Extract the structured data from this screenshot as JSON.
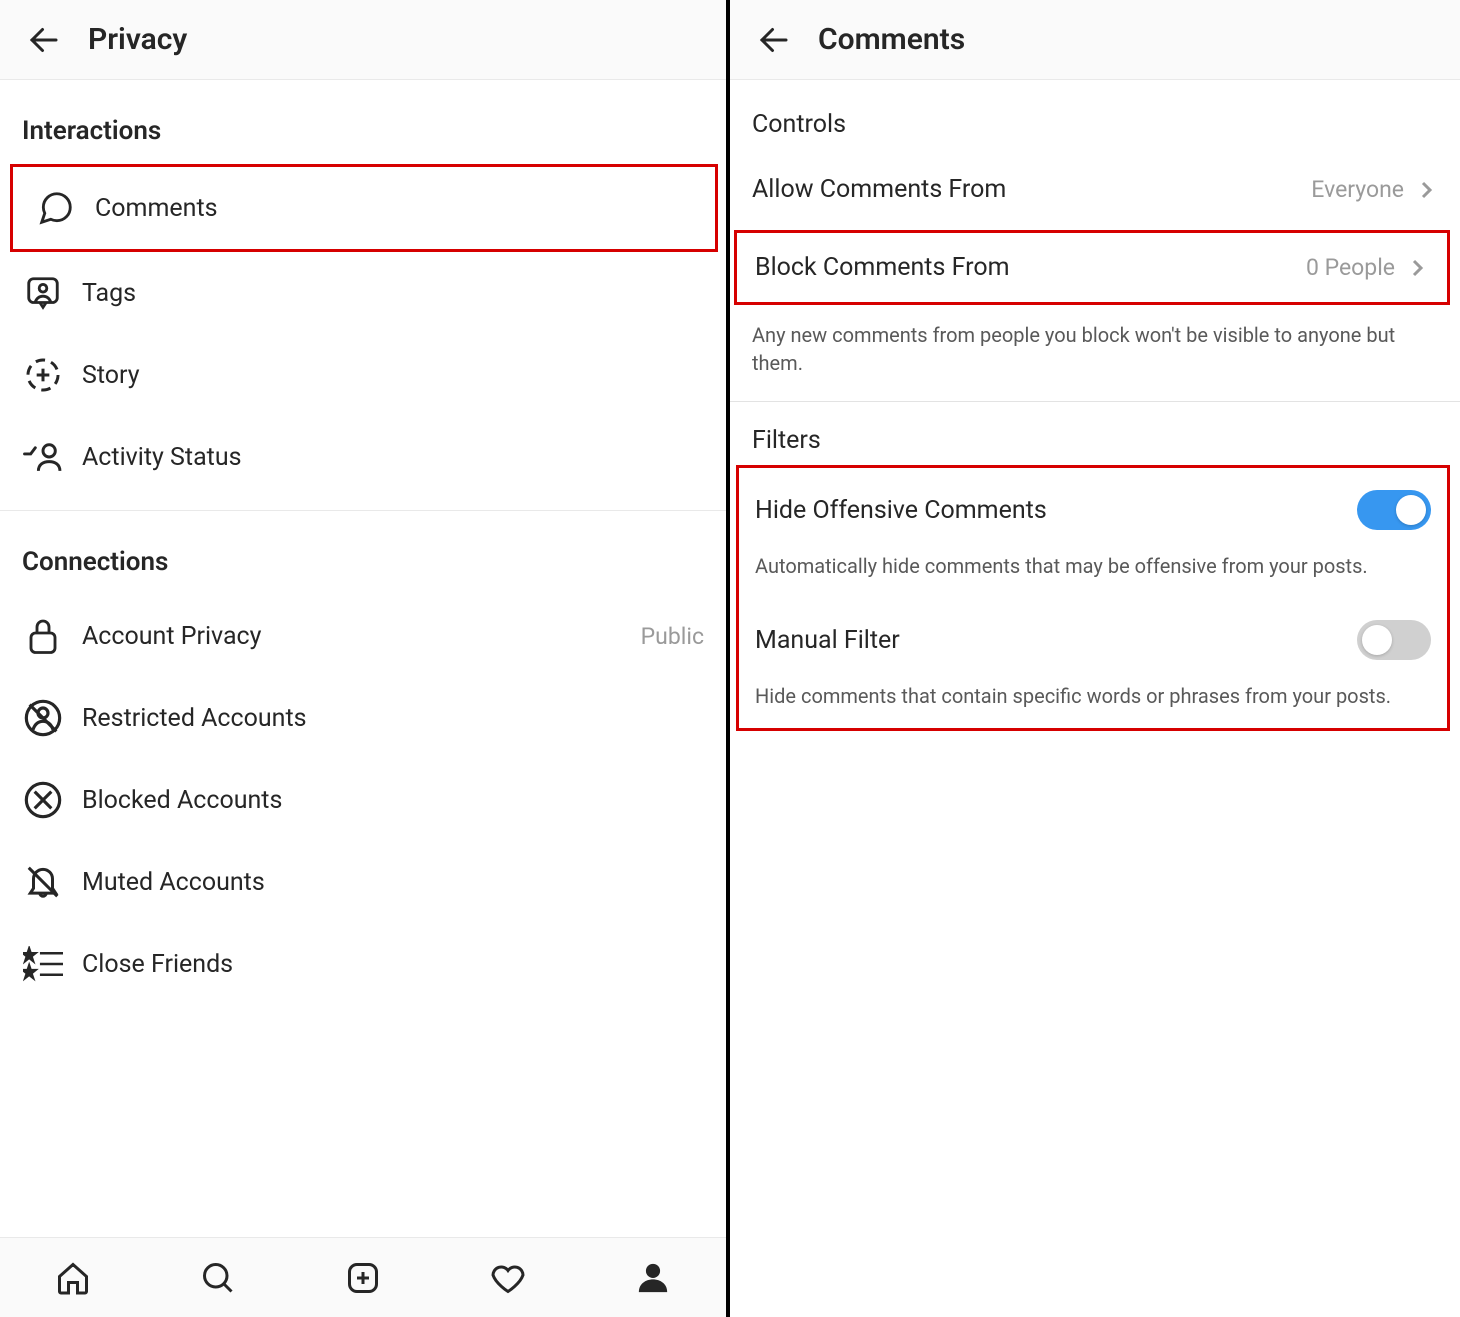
{
  "left": {
    "title": "Privacy",
    "sections": {
      "interactions": {
        "header": "Interactions",
        "items": {
          "comments": "Comments",
          "tags": "Tags",
          "story": "Story",
          "activity_status": "Activity Status"
        }
      },
      "connections": {
        "header": "Connections",
        "items": {
          "account_privacy": "Account Privacy",
          "account_privacy_value": "Public",
          "restricted": "Restricted Accounts",
          "blocked": "Blocked Accounts",
          "muted": "Muted Accounts",
          "close_friends": "Close Friends"
        }
      }
    }
  },
  "right": {
    "title": "Comments",
    "controls": {
      "header": "Controls",
      "allow_label": "Allow Comments From",
      "allow_value": "Everyone",
      "block_label": "Block Comments From",
      "block_value": "0 People",
      "block_desc": "Any new comments from people you block won't be visible to anyone but them."
    },
    "filters": {
      "header": "Filters",
      "hide_label": "Hide Offensive Comments",
      "hide_desc": "Automatically hide comments that may be offensive from your posts.",
      "manual_label": "Manual Filter",
      "manual_desc": "Hide comments that contain specific words or phrases from your posts."
    }
  }
}
